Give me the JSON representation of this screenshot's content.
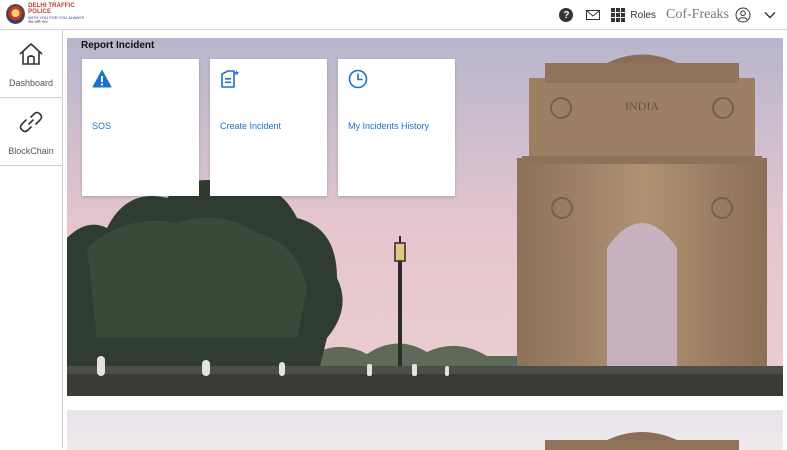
{
  "header": {
    "logo_line1": "DELHI TRAFFIC POLICE",
    "logo_line2": "WITH YOU FOR YOU ALWAYS",
    "logo_line3": "सेवा शांति न्याय",
    "help_glyph": "?",
    "roles_label": "Roles",
    "user_name": "Cof-Freaks"
  },
  "sidebar": {
    "items": [
      {
        "label": "Dashboard",
        "icon": "home-icon"
      },
      {
        "label": "BlockChain",
        "icon": "link-icon"
      }
    ]
  },
  "main": {
    "section_title": "Report Incident",
    "cards": [
      {
        "label": "SOS",
        "icon": "warning-icon"
      },
      {
        "label": "Create Incident",
        "icon": "new-document-icon"
      },
      {
        "label": "My Incidents History",
        "icon": "clock-icon"
      }
    ],
    "banner_text": "INDIA"
  },
  "colors": {
    "accent": "#1a72c9",
    "sky_top": "#b9b7cf",
    "sky_bottom": "#e8c6cd",
    "stone": "#a88a6a"
  }
}
